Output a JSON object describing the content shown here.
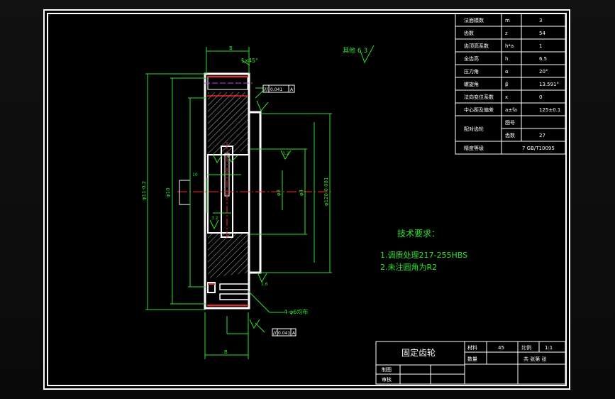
{
  "drawing": {
    "part_name": "固定齿轮",
    "roughness_note": "其他 6.3",
    "tech_requirements": {
      "title": "技术要求：",
      "items": [
        "1.调质处理217-255HBS",
        "2.未注圆角为R2"
      ]
    },
    "dims": {
      "top_width": "B",
      "edge_chamfer": "1x45°",
      "bore_left": "φ11",
      "d_main": "φ11-0.2",
      "d_hub": "φ10",
      "width_small": "10",
      "d_bore": "φ4",
      "d_center": "φ3",
      "d_pitch": "φ120-0.081",
      "holes": "4-φ6均布",
      "bottom_width": "B",
      "slot_note": "3.2",
      "rough_low": "1.6",
      "rough_mid": "3.2"
    },
    "tolerance_frames": [
      {
        "symbol": "//",
        "value": "0.041",
        "datum": "A"
      },
      {
        "symbol": "//",
        "value": "0.041",
        "datum": "A"
      }
    ]
  },
  "params_table": [
    {
      "label": "法面模数",
      "sym": "m",
      "value": "3"
    },
    {
      "label": "齿数",
      "sym": "z",
      "value": "54"
    },
    {
      "label": "齿顶高系数",
      "sym": "h*a",
      "value": "1"
    },
    {
      "label": "全齿高",
      "sym": "h",
      "value": "6.5"
    },
    {
      "label": "压力角",
      "sym": "α",
      "value": "20°"
    },
    {
      "label": "螺旋角",
      "sym": "β",
      "value": "13.591°"
    },
    {
      "label": "法向变位系数",
      "sym": "x",
      "value": "0"
    },
    {
      "label": "中心距及偏差",
      "sym": "a±fa",
      "value": "125±0.1"
    },
    {
      "label": "配对齿轮",
      "sym": "图号",
      "value": ""
    },
    {
      "label": "",
      "sym": "齿数",
      "value": "27"
    },
    {
      "label": "精度等级",
      "sym": "",
      "value": "7 GB/T10095"
    }
  ],
  "title_block": {
    "material_label": "材料",
    "material_value": "45",
    "scale_label": "比例",
    "scale_value": "1:1",
    "count_label": "数量",
    "sheets_text": "共  张第  张",
    "drawn_label": "制图",
    "checked_label": "审核"
  }
}
